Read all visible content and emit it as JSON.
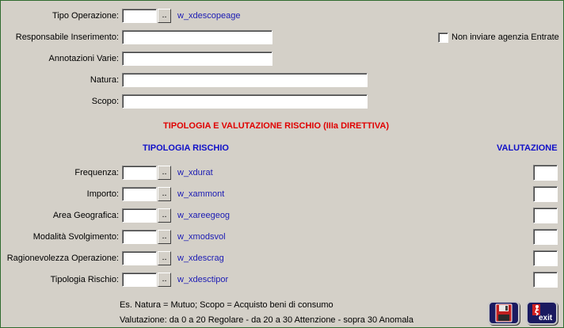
{
  "top": {
    "tipo_operazione": {
      "label": "Tipo Operazione:",
      "value": "",
      "lookup": "..",
      "code": "w_xdescopeage"
    },
    "responsabile": {
      "label": "Responsabile Inserimento:",
      "value": ""
    },
    "annotazioni": {
      "label": "Annotazioni Varie:",
      "value": ""
    },
    "natura": {
      "label": "Natura:",
      "value": ""
    },
    "scopo": {
      "label": "Scopo:",
      "value": ""
    },
    "non_inviare": {
      "label": "Non inviare agenzia Entrate",
      "checked": false
    }
  },
  "section_title": "TIPOLOGIA E VALUTAZIONE RISCHIO (IIIa DIRETTIVA)",
  "col_tipologia": "TIPOLOGIA RISCHIO",
  "col_valutazione": "VALUTAZIONE",
  "risk_rows": [
    {
      "label": "Frequenza:",
      "value": "",
      "lookup": "..",
      "code": "w_xdurat",
      "score": ""
    },
    {
      "label": "Importo:",
      "value": "",
      "lookup": "..",
      "code": "w_xammont",
      "score": ""
    },
    {
      "label": "Area Geografica:",
      "value": "",
      "lookup": "..",
      "code": "w_xareegeog",
      "score": ""
    },
    {
      "label": "Modalità Svolgimento:",
      "value": "",
      "lookup": "..",
      "code": "w_xmodsvol",
      "score": ""
    },
    {
      "label": "Ragionevolezza Operazione:",
      "value": "",
      "lookup": "..",
      "code": "w_xdescrag",
      "score": ""
    },
    {
      "label": "Tipologia Rischio:",
      "value": "",
      "lookup": "..",
      "code": "w_xdesctipor",
      "score": ""
    }
  ],
  "notes": {
    "line1": "Es. Natura = Mutuo; Scopo = Acquisto beni di consumo",
    "line2": "Valutazione: da 0 a 20 Regolare - da 20 a 30 Attenzione - sopra 30 Anomala"
  },
  "buttons": {
    "save_icon": "floppy-disk-icon",
    "exit_label": "exit",
    "exit_icon": "exit-door-icon"
  },
  "colors": {
    "background": "#d4d0c8",
    "section_title": "#e00000",
    "headers": "#1010c8",
    "codes": "#1a1ab4",
    "button_bg": "#1a1a60"
  }
}
